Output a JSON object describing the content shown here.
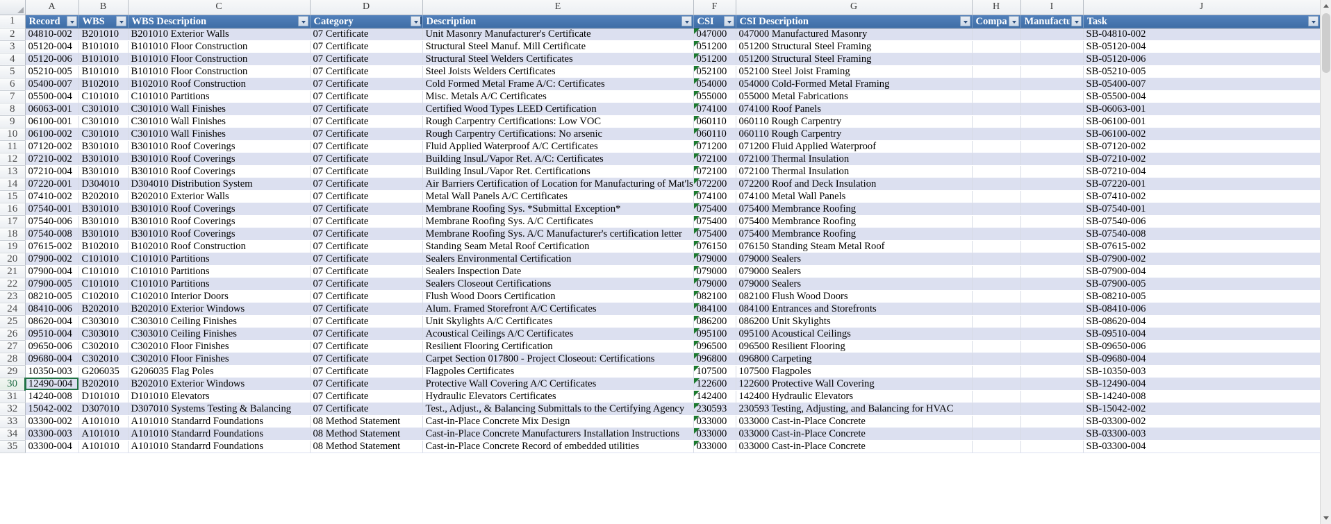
{
  "app": {
    "type": "spreadsheet",
    "selected_cell": "A30",
    "accent_color": "#4472a8",
    "banding_color": "#dce0f0",
    "selection_color": "#207245",
    "error_flag_color": "#1b7a2e"
  },
  "column_letters": [
    "A",
    "B",
    "C",
    "D",
    "E",
    "F",
    "G",
    "H",
    "I",
    "J"
  ],
  "headers": [
    {
      "key": "record",
      "label": "Record",
      "filter": true,
      "sorted": false
    },
    {
      "key": "wbs",
      "label": "WBS",
      "filter": true,
      "sorted": false
    },
    {
      "key": "wbs_description",
      "label": "WBS Description",
      "filter": true,
      "sorted": false
    },
    {
      "key": "category",
      "label": "Category",
      "filter": true,
      "sorted": true
    },
    {
      "key": "description",
      "label": "Description",
      "filter": true,
      "sorted": false
    },
    {
      "key": "csi",
      "label": "CSI",
      "filter": true,
      "sorted": false
    },
    {
      "key": "csi_description",
      "label": "CSI Description",
      "filter": true,
      "sorted": false
    },
    {
      "key": "company",
      "label": "Company",
      "filter": true,
      "sorted": false
    },
    {
      "key": "manufacturer",
      "label": "Manufacturer",
      "filter": true,
      "sorted": false
    },
    {
      "key": "task",
      "label": "Task",
      "filter": true,
      "sorted": false
    }
  ],
  "header_row_number": "1",
  "rows": [
    {
      "n": "2",
      "record": "04810-002",
      "wbs": "B201010",
      "wbs_description": "B201010 Exterior Walls",
      "category": "07 Certificate",
      "description": "Unit Masonry Manufacturer's Certificate",
      "csi": "047000",
      "csi_description": "047000 Manufactured Masonry",
      "company": "",
      "manufacturer": "",
      "task": "SB-04810-002"
    },
    {
      "n": "3",
      "record": "05120-004",
      "wbs": "B101010",
      "wbs_description": "B101010 Floor Construction",
      "category": "07 Certificate",
      "description": "Structural Steel Manuf. Mill Certificate",
      "csi": "051200",
      "csi_description": "051200 Structural Steel Framing",
      "company": "",
      "manufacturer": "",
      "task": "SB-05120-004"
    },
    {
      "n": "4",
      "record": "05120-006",
      "wbs": "B101010",
      "wbs_description": "B101010 Floor Construction",
      "category": "07 Certificate",
      "description": "Structural Steel Welders Certificates",
      "csi": "051200",
      "csi_description": "051200 Structural Steel Framing",
      "company": "",
      "manufacturer": "",
      "task": "SB-05120-006"
    },
    {
      "n": "5",
      "record": "05210-005",
      "wbs": "B101010",
      "wbs_description": "B101010 Floor Construction",
      "category": "07 Certificate",
      "description": "Steel Joists Welders Certificates",
      "csi": "052100",
      "csi_description": "052100 Steel Joist Framing",
      "company": "",
      "manufacturer": "",
      "task": "SB-05210-005"
    },
    {
      "n": "6",
      "record": "05400-007",
      "wbs": "B102010",
      "wbs_description": "B102010 Roof Construction",
      "category": "07 Certificate",
      "description": "Cold Formed Metal Frame A/C: Certificates",
      "csi": "054000",
      "csi_description": "054000 Cold-Formed Metal Framing",
      "company": "",
      "manufacturer": "",
      "task": "SB-05400-007"
    },
    {
      "n": "7",
      "record": "05500-004",
      "wbs": "C101010",
      "wbs_description": "C101010 Partitions",
      "category": "07 Certificate",
      "description": "Misc. Metals A/C Certificates",
      "csi": "055000",
      "csi_description": "055000 Metal Fabrications",
      "company": "",
      "manufacturer": "",
      "task": "SB-05500-004"
    },
    {
      "n": "8",
      "record": "06063-001",
      "wbs": "C301010",
      "wbs_description": "C301010 Wall Finishes",
      "category": "07 Certificate",
      "description": "Certified Wood Types LEED Certification",
      "csi": "074100",
      "csi_description": "074100 Roof Panels",
      "company": "",
      "manufacturer": "",
      "task": "SB-06063-001"
    },
    {
      "n": "9",
      "record": "06100-001",
      "wbs": "C301010",
      "wbs_description": "C301010 Wall Finishes",
      "category": "07 Certificate",
      "description": "Rough Carpentry Certifications: Low VOC",
      "csi": "060110",
      "csi_description": "060110 Rough Carpentry",
      "company": "",
      "manufacturer": "",
      "task": "SB-06100-001"
    },
    {
      "n": "10",
      "record": "06100-002",
      "wbs": "C301010",
      "wbs_description": "C301010 Wall Finishes",
      "category": "07 Certificate",
      "description": "Rough Carpentry Certifications: No arsenic",
      "csi": "060110",
      "csi_description": "060110 Rough Carpentry",
      "company": "",
      "manufacturer": "",
      "task": "SB-06100-002"
    },
    {
      "n": "11",
      "record": "07120-002",
      "wbs": "B301010",
      "wbs_description": "B301010 Roof Coverings",
      "category": "07 Certificate",
      "description": "Fluid Applied Waterproof A/C Certificates",
      "csi": "071200",
      "csi_description": "071200 Fluid Applied Waterproof",
      "company": "",
      "manufacturer": "",
      "task": "SB-07120-002"
    },
    {
      "n": "12",
      "record": "07210-002",
      "wbs": "B301010",
      "wbs_description": "B301010 Roof Coverings",
      "category": "07 Certificate",
      "description": "Building Insul./Vapor Ret. A/C: Certificates",
      "csi": "072100",
      "csi_description": "072100 Thermal Insulation",
      "company": "",
      "manufacturer": "",
      "task": "SB-07210-002"
    },
    {
      "n": "13",
      "record": "07210-004",
      "wbs": "B301010",
      "wbs_description": "B301010 Roof Coverings",
      "category": "07 Certificate",
      "description": "Building Insul./Vapor Ret. Certifications",
      "csi": "072100",
      "csi_description": "072100 Thermal Insulation",
      "company": "",
      "manufacturer": "",
      "task": "SB-07210-004"
    },
    {
      "n": "14",
      "record": "07220-001",
      "wbs": "D304010",
      "wbs_description": "D304010 Distribution System",
      "category": "07 Certificate",
      "description": "Air Barriers Certification of Location for Manufacturing of Mat'ls",
      "csi": "072200",
      "csi_description": "072200 Roof and Deck Insulation",
      "company": "",
      "manufacturer": "",
      "task": "SB-07220-001"
    },
    {
      "n": "15",
      "record": "07410-002",
      "wbs": "B202010",
      "wbs_description": "B202010 Exterior Walls",
      "category": "07 Certificate",
      "description": "Metal Wall Panels A/C Certificates",
      "csi": "074100",
      "csi_description": "074100 Metal Wall Panels",
      "company": "",
      "manufacturer": "",
      "task": "SB-07410-002"
    },
    {
      "n": "16",
      "record": "07540-001",
      "wbs": "B301010",
      "wbs_description": "B301010 Roof Coverings",
      "category": "07 Certificate",
      "description": "Membrane Roofing Sys. *Submittal Exception*",
      "csi": "075400",
      "csi_description": "075400 Membrance Roofing",
      "company": "",
      "manufacturer": "",
      "task": "SB-07540-001"
    },
    {
      "n": "17",
      "record": "07540-006",
      "wbs": "B301010",
      "wbs_description": "B301010 Roof Coverings",
      "category": "07 Certificate",
      "description": "Membrane Roofing Sys. A/C Certificates",
      "csi": "075400",
      "csi_description": "075400 Membrance Roofing",
      "company": "",
      "manufacturer": "",
      "task": "SB-07540-006"
    },
    {
      "n": "18",
      "record": "07540-008",
      "wbs": "B301010",
      "wbs_description": "B301010 Roof Coverings",
      "category": "07 Certificate",
      "description": "Membrane Roofing Sys. A/C Manufacturer's certification letter",
      "csi": "075400",
      "csi_description": "075400 Membrance Roofing",
      "company": "",
      "manufacturer": "",
      "task": "SB-07540-008"
    },
    {
      "n": "19",
      "record": "07615-002",
      "wbs": "B102010",
      "wbs_description": "B102010 Roof Construction",
      "category": "07 Certificate",
      "description": "Standing Seam Metal Roof Certification",
      "csi": "076150",
      "csi_description": "076150 Standing Steam Metal Roof",
      "company": "",
      "manufacturer": "",
      "task": "SB-07615-002"
    },
    {
      "n": "20",
      "record": "07900-002",
      "wbs": "C101010",
      "wbs_description": "C101010 Partitions",
      "category": "07 Certificate",
      "description": "Sealers Environmental Certification",
      "csi": "079000",
      "csi_description": "079000 Sealers",
      "company": "",
      "manufacturer": "",
      "task": "SB-07900-002"
    },
    {
      "n": "21",
      "record": "07900-004",
      "wbs": "C101010",
      "wbs_description": "C101010 Partitions",
      "category": "07 Certificate",
      "description": "Sealers Inspection Date",
      "csi": "079000",
      "csi_description": "079000 Sealers",
      "company": "",
      "manufacturer": "",
      "task": "SB-07900-004"
    },
    {
      "n": "22",
      "record": "07900-005",
      "wbs": "C101010",
      "wbs_description": "C101010 Partitions",
      "category": "07 Certificate",
      "description": "Sealers Closeout Certifications",
      "csi": "079000",
      "csi_description": "079000 Sealers",
      "company": "",
      "manufacturer": "",
      "task": "SB-07900-005"
    },
    {
      "n": "23",
      "record": "08210-005",
      "wbs": "C102010",
      "wbs_description": "C102010 Interior Doors",
      "category": "07 Certificate",
      "description": "Flush Wood Doors Certification",
      "csi": "082100",
      "csi_description": "082100 Flush Wood Doors",
      "company": "",
      "manufacturer": "",
      "task": "SB-08210-005"
    },
    {
      "n": "24",
      "record": "08410-006",
      "wbs": "B202010",
      "wbs_description": "B202010 Exterior Windows",
      "category": "07 Certificate",
      "description": "Alum. Framed Storefront A/C Certificates",
      "csi": "084100",
      "csi_description": "084100 Entrances and Storefronts",
      "company": "",
      "manufacturer": "",
      "task": "SB-08410-006"
    },
    {
      "n": "25",
      "record": "08620-004",
      "wbs": "C303010",
      "wbs_description": "C303010 Ceiling Finishes",
      "category": "07 Certificate",
      "description": "Unit Skylights A/C Certificates",
      "csi": "086200",
      "csi_description": "086200 Unit Skylights",
      "company": "",
      "manufacturer": "",
      "task": "SB-08620-004"
    },
    {
      "n": "26",
      "record": "09510-004",
      "wbs": "C303010",
      "wbs_description": "C303010 Ceiling Finishes",
      "category": "07 Certificate",
      "description": "Acoustical Ceilings A/C Certificates",
      "csi": "095100",
      "csi_description": "095100 Acoustical Ceilings",
      "company": "",
      "manufacturer": "",
      "task": "SB-09510-004"
    },
    {
      "n": "27",
      "record": "09650-006",
      "wbs": "C302010",
      "wbs_description": "C302010 Floor Finishes",
      "category": "07 Certificate",
      "description": "Resilient Flooring Certification",
      "csi": "096500",
      "csi_description": "096500 Resilient Flooring",
      "company": "",
      "manufacturer": "",
      "task": "SB-09650-006"
    },
    {
      "n": "28",
      "record": "09680-004",
      "wbs": "C302010",
      "wbs_description": "C302010 Floor Finishes",
      "category": "07 Certificate",
      "description": "Carpet Section 017800 - Project Closeout: Certifications",
      "csi": "096800",
      "csi_description": "096800 Carpeting",
      "company": "",
      "manufacturer": "",
      "task": "SB-09680-004"
    },
    {
      "n": "29",
      "record": "10350-003",
      "wbs": "G206035",
      "wbs_description": "G206035 Flag Poles",
      "category": "07 Certificate",
      "description": "Flagpoles Certificates",
      "csi": "107500",
      "csi_description": "107500 Flagpoles",
      "company": "",
      "manufacturer": "",
      "task": "SB-10350-003"
    },
    {
      "n": "30",
      "record": "12490-004",
      "wbs": "B202010",
      "wbs_description": "B202010 Exterior Windows",
      "category": "07 Certificate",
      "description": "Protective Wall Covering A/C Certificates",
      "csi": "122600",
      "csi_description": "122600 Protective Wall Covering",
      "company": "",
      "manufacturer": "",
      "task": "SB-12490-004"
    },
    {
      "n": "31",
      "record": "14240-008",
      "wbs": "D101010",
      "wbs_description": "D101010 Elevators",
      "category": "07 Certificate",
      "description": "Hydraulic Elevators Certificates",
      "csi": "142400",
      "csi_description": "142400 Hydraulic Elevators",
      "company": "",
      "manufacturer": "",
      "task": "SB-14240-008"
    },
    {
      "n": "32",
      "record": "15042-002",
      "wbs": "D307010",
      "wbs_description": "D307010 Systems Testing & Balancing",
      "category": "07 Certificate",
      "description": "Test., Adjust., & Balancing Submittals to the Certifying Agency",
      "csi": "230593",
      "csi_description": "230593 Testing, Adjusting, and Balancing for HVAC",
      "company": "",
      "manufacturer": "",
      "task": "SB-15042-002"
    },
    {
      "n": "33",
      "record": "03300-002",
      "wbs": "A101010",
      "wbs_description": "A101010 Standarrd Foundations",
      "category": "08 Method Statement",
      "description": "Cast-in-Place Concrete Mix Design",
      "csi": "033000",
      "csi_description": "033000 Cast-in-Place Concrete",
      "company": "",
      "manufacturer": "",
      "task": "SB-03300-002"
    },
    {
      "n": "34",
      "record": "03300-003",
      "wbs": "A101010",
      "wbs_description": "A101010 Standarrd Foundations",
      "category": "08 Method Statement",
      "description": "Cast-in-Place Concrete Manufacturers Installation Instructions",
      "csi": "033000",
      "csi_description": "033000 Cast-in-Place Concrete",
      "company": "",
      "manufacturer": "",
      "task": "SB-03300-003"
    },
    {
      "n": "35",
      "record": "03300-004",
      "wbs": "A101010",
      "wbs_description": "A101010 Standarrd Foundations",
      "category": "08 Method Statement",
      "description": "Cast-in-Place Concrete Record of embedded utilities",
      "csi": "033000",
      "csi_description": "033000 Cast-in-Place Concrete",
      "company": "",
      "manufacturer": "",
      "task": "SB-03300-004"
    }
  ],
  "scrollbar": {
    "up_arrow": "scroll-up-arrow",
    "down_arrow": "scroll-down-arrow"
  }
}
